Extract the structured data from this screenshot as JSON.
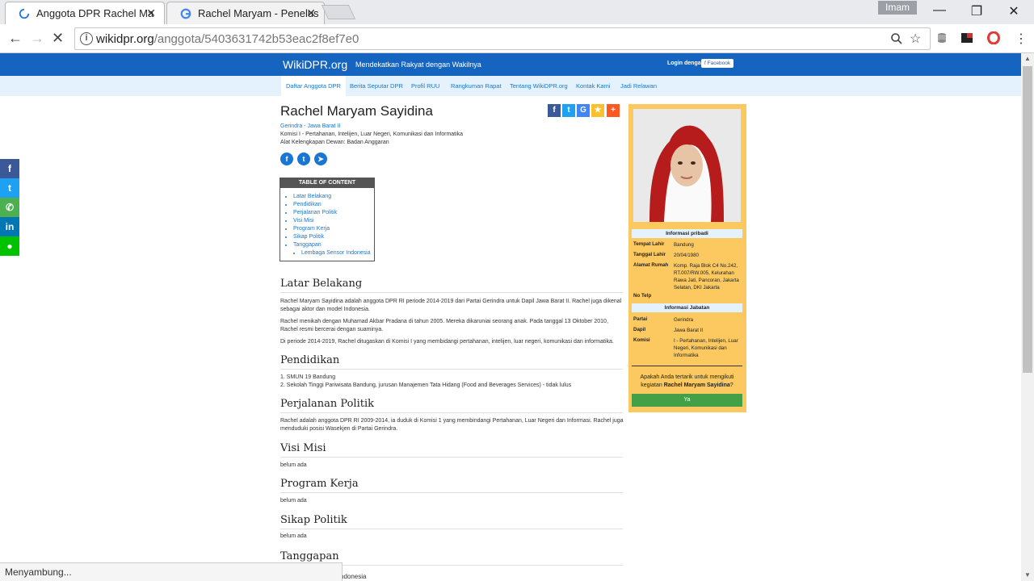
{
  "browser": {
    "tabs": [
      {
        "title": "Anggota DPR Rachel Ma",
        "close": "✕"
      },
      {
        "title": "Rachel Maryam - Penelus",
        "close": "✕"
      }
    ],
    "user": "Imam",
    "window": {
      "minimize": "—",
      "restore": "❐",
      "close": "✕"
    },
    "url_domain": "wikidpr.org",
    "url_path": "/anggota/5403631742b53eac2f8ef7e0",
    "status": "Menyambung..."
  },
  "site": {
    "brand": "WikiDPR.org",
    "tagline": "Mendekatkan Rakyat dengan Wakilnya",
    "login_label": "Login dengan",
    "facebook_label": "f Facebook",
    "nav": [
      "Daftar Anggota DPR",
      "Berita Seputar DPR",
      "Profil RUU",
      "Rangkuman Rapat",
      "Tentang WikiDPR.org",
      "Kontak Kami",
      "Jadi Relawan"
    ]
  },
  "profile": {
    "name": "Rachel Maryam Sayidina",
    "party_region": "Gerindra - Jawa Barat II",
    "commission": "Komisi I - Pertahanan, Intelijen, Luar Negeri, Komunikasi dan Informatika",
    "council": "Alat Kelengkapan Dewan: Badan Anggaran"
  },
  "toc": {
    "title": "TABLE OF CONTENT",
    "items": [
      "Latar Belakang",
      "Pendidikan",
      "Perjalanan Politik",
      "Visi Misi",
      "Program Kerja",
      "Sikap Politik",
      "Tanggapan"
    ],
    "subitems": [
      "Lembaga Sensor Indonesia"
    ]
  },
  "sections": {
    "latar": {
      "title": "Latar Belakang",
      "p1": "Rachel Maryam Sayidina adalah anggota DPR RI periode 2014-2019 dari Partai Gerindra untuk Dapil Jawa Barat II. Rachel juga dikenal sebagai aktor dan model Indonesia.",
      "p2": "Rachel menikah dengan Muhamad Akbar Pradana di tahun 2005. Mereka dikaruniai seorang anak. Pada tanggal 13 Oktober 2010, Rachel resmi bercerai dengan suaminya.",
      "p3": "Di periode 2014-2019, Rachel ditugaskan di Komisi I yang membidangi pertahanan, intelijen, luar negeri, komunikasi dan informatika."
    },
    "pendidikan": {
      "title": "Pendidikan",
      "l1": "1. SMUN 19 Bandung",
      "l2": "2. Sekolah Tinggi Pariwisata Bandung, jurusan Manajemen Tata Hidang (Food and Beverages Services) - tidak lulus"
    },
    "politik": {
      "title": "Perjalanan Politik",
      "p1": "Rachel adalah anggota DPR RI 2009-2014, ia duduk di Komisi 1 yang membindangi Pertahanan, Luar Negeri dan Informasi. Rachel juga menduduki posisi Wasekjen di Partai Gerindra."
    },
    "visi": {
      "title": "Visi Misi",
      "body": "belum ada"
    },
    "program": {
      "title": "Program Kerja",
      "body": "belum ada"
    },
    "sikap": {
      "title": "Sikap Politik",
      "body": "belum ada"
    },
    "tanggapan": {
      "title": "Tanggapan",
      "body": "Lembaga Sensor Indonesia",
      "visible_tail": "ndonesia"
    }
  },
  "card": {
    "personal_title": "Informasi pribadi",
    "tempat_k": "Tempat Lahir",
    "tempat_v": "Bandung",
    "tanggal_k": "Tanggal Lahir",
    "tanggal_v": "20/04/1980",
    "alamat_k": "Alamat Rumah",
    "alamat_v": "Komp. Raja Blok C4 No.242, RT.007/RW.005, Kelurahan Rawa Jati, Pancoran, Jakarta Selatan, DKI Jakarta",
    "telp_k": "No Telp",
    "telp_v": "",
    "jabatan_title": "Informasi Jabatan",
    "partai_k": "Partai",
    "partai_v": "Gerindra",
    "dapil_k": "Dapil",
    "dapil_v": "Jawa Barat II",
    "komisi_k": "Komisi",
    "komisi_v": "I - Pertahanan, Intelijen, Luar Negeri, Komunikasi dan Informatika",
    "question_pre": "Apakah Anda tertarik untuk mengikuti kegiatan",
    "question_name": "Rachel Maryam Sayidina",
    "question_post": "?",
    "button": "Ya"
  },
  "colors": {
    "brand_blue": "#1565c0",
    "subnav_bg": "#e3f2fd",
    "card_bg": "#fbc960",
    "green": "#43a047"
  }
}
